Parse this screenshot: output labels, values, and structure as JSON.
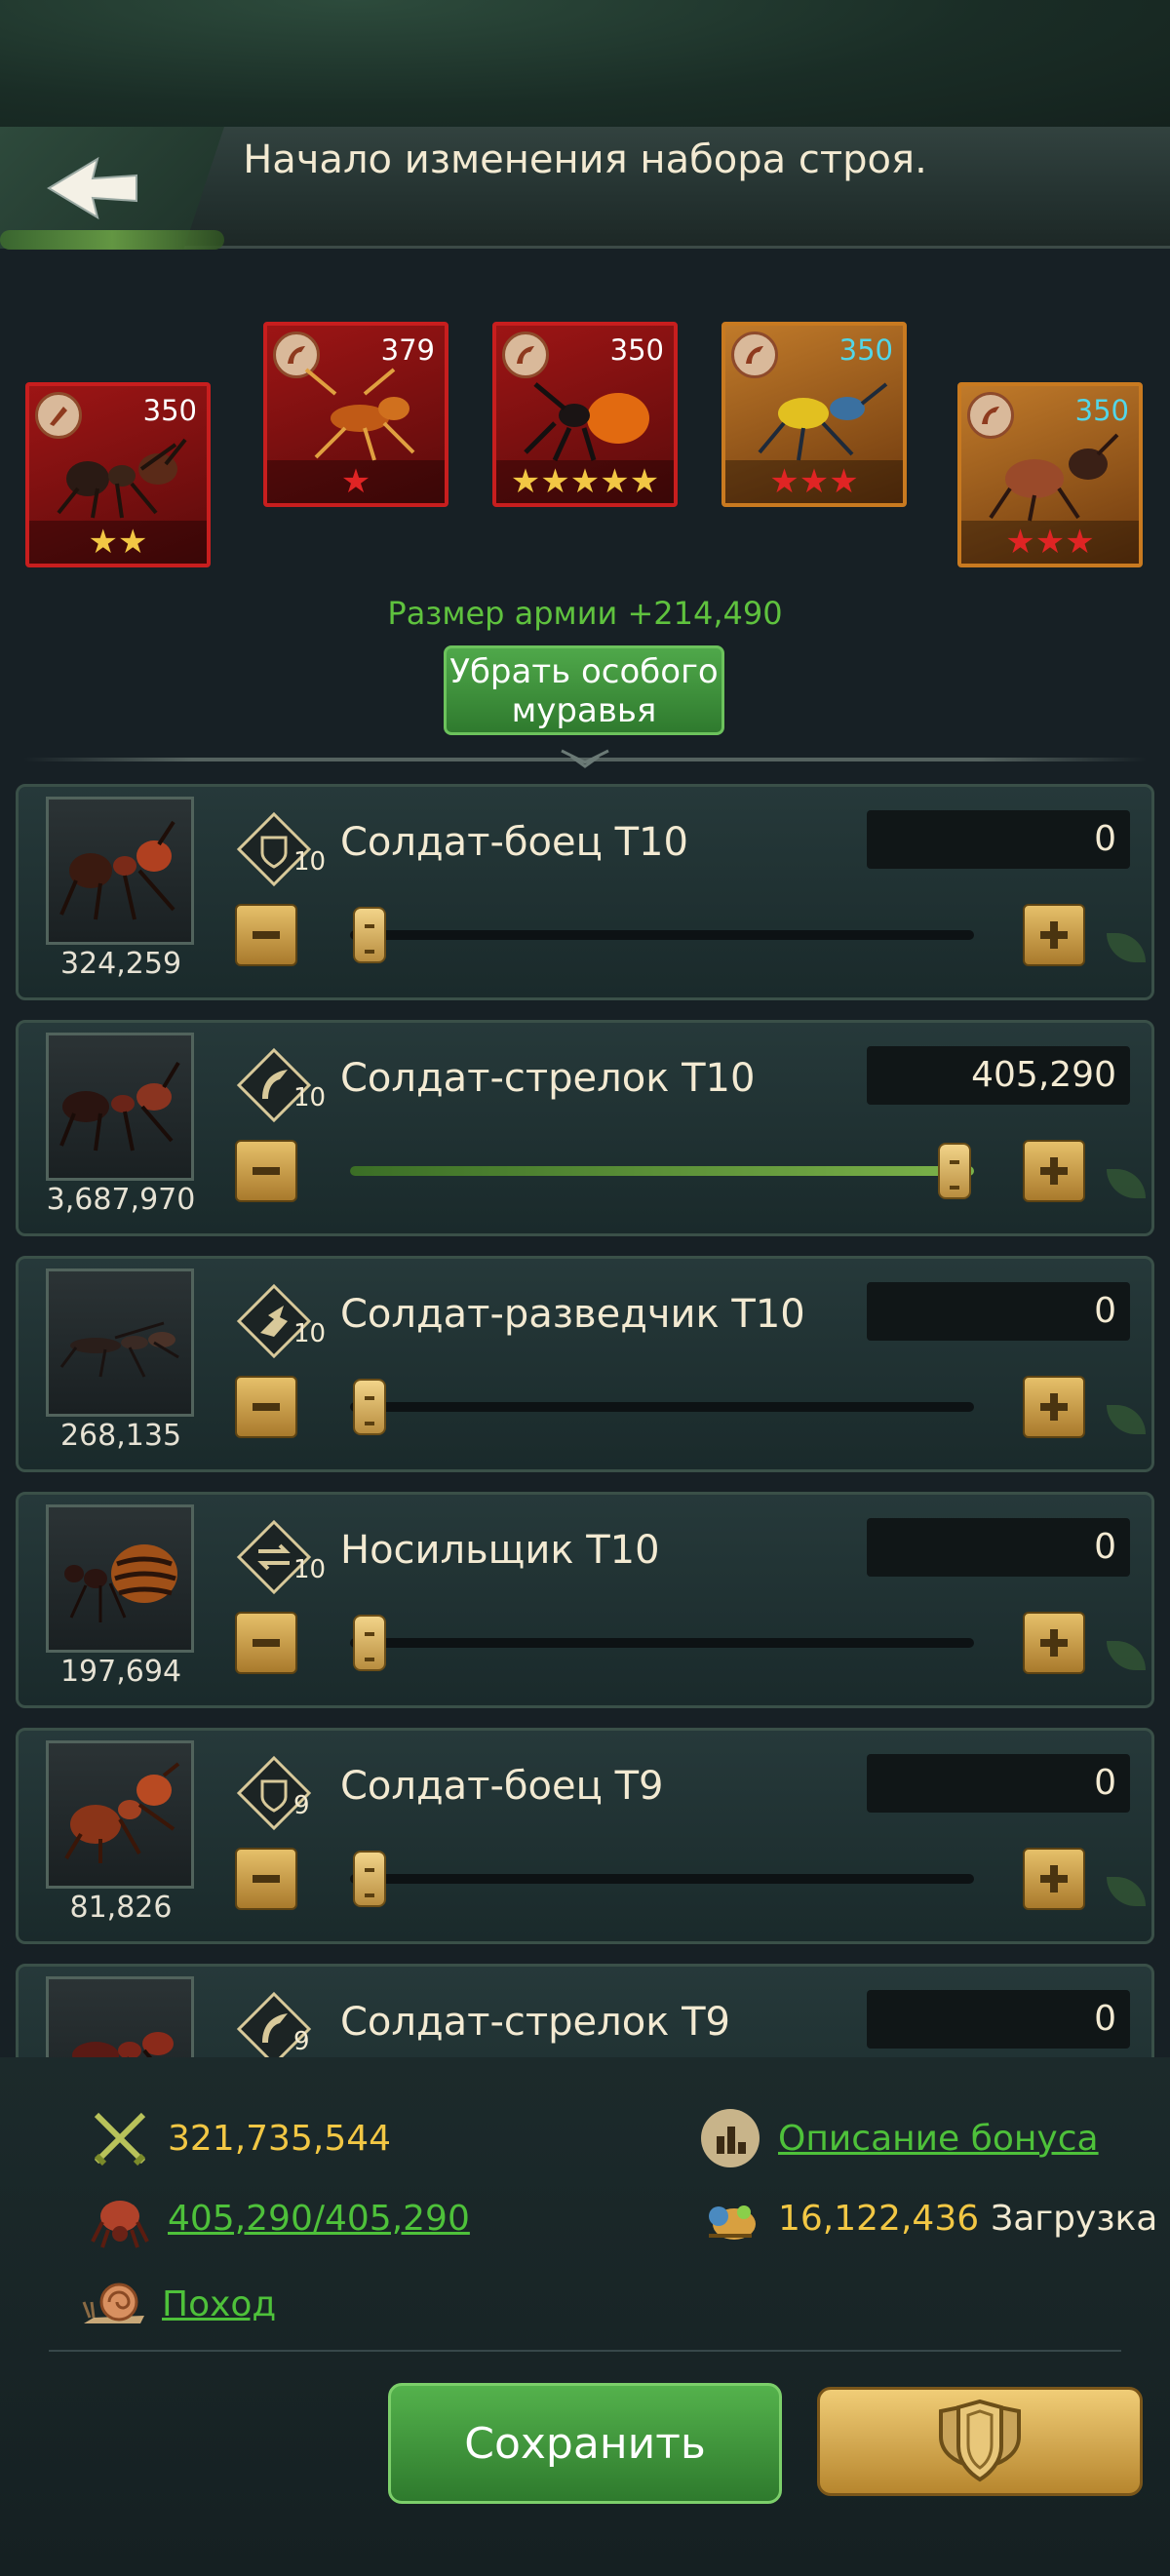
{
  "header": {
    "title": "Начало изменения набора строя."
  },
  "special_ants": [
    {
      "level": "350",
      "stars": "★★",
      "star_color": "gold",
      "frame": "red",
      "icon": "melee-class-icon"
    },
    {
      "level": "379",
      "stars": "★",
      "star_color": "red",
      "frame": "red",
      "icon": "ranged-class-icon"
    },
    {
      "level": "350",
      "stars": "★★★★★",
      "star_color": "gold",
      "frame": "red",
      "icon": "ranged-class-icon"
    },
    {
      "level": "350",
      "stars": "★★★",
      "star_color": "red",
      "frame": "gold",
      "icon": "ranged-class-icon"
    },
    {
      "level": "350",
      "stars": "★★★",
      "star_color": "red",
      "frame": "gold",
      "icon": "ranged-class-icon"
    }
  ],
  "army_size": "Размер армии +214,490",
  "remove_button": {
    "line1": "Убрать особого",
    "line2": "муравья"
  },
  "troops": [
    {
      "name": "Солдат-боец T10",
      "tier": "10",
      "count": "324,259",
      "value": "0",
      "fraction": 0,
      "type_icon": "guardian-shield-icon"
    },
    {
      "name": "Солдат-стрелок T10",
      "tier": "10",
      "count": "3,687,970",
      "value": "405,290",
      "fraction": 1,
      "type_icon": "shooter-icon"
    },
    {
      "name": "Солдат-разведчик T10",
      "tier": "10",
      "count": "268,135",
      "value": "0",
      "fraction": 0,
      "type_icon": "scout-icon"
    },
    {
      "name": "Носильщик T10",
      "tier": "10",
      "count": "197,694",
      "value": "0",
      "fraction": 0,
      "type_icon": "carrier-icon"
    },
    {
      "name": "Солдат-боец T9",
      "tier": "9",
      "count": "81,826",
      "value": "0",
      "fraction": 0,
      "type_icon": "guardian-shield-icon"
    },
    {
      "name": "Солдат-стрелок T9",
      "tier": "9",
      "count": "",
      "value": "0",
      "fraction": 0,
      "type_icon": "shooter-icon"
    }
  ],
  "stats": {
    "power": "321,735,544",
    "troops_ratio": "405,290/405,290",
    "march": "Поход",
    "bonus_link": "Описание бонуса",
    "load_value": "16,122,436",
    "load_label": "Загрузка"
  },
  "buttons": {
    "save": "Сохранить"
  },
  "colors": {
    "accent_green": "#4ec13a",
    "gold_text": "#f2c744",
    "panel_bg": "#1a2a2b"
  }
}
